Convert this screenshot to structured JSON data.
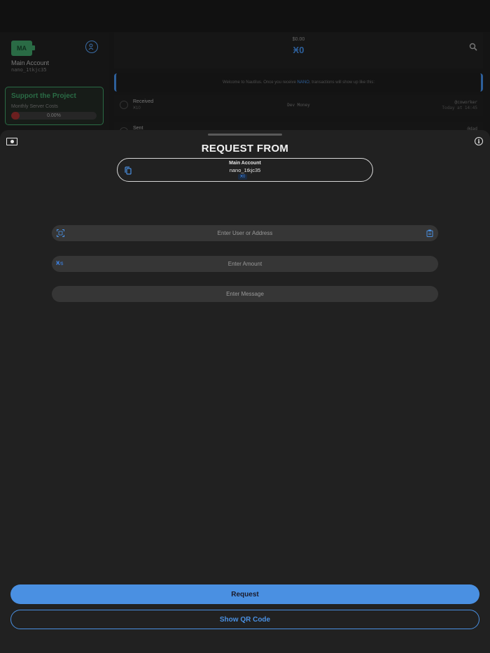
{
  "background": {
    "sidebar": {
      "avatar_initials": "MA",
      "account_name": "Main Account",
      "account_address": "nano_1tkjc35",
      "support": {
        "title": "Support the Project",
        "subtitle": "Monthly Server Costs",
        "progress_label": "0.00%",
        "progress": 0.0
      }
    },
    "header": {
      "fiat_balance": "$0.00",
      "nano_balance": "Ӿ0"
    },
    "welcome": {
      "prefix": "Welcome to Nautilus. Once you receive ",
      "highlight": "NANO",
      "suffix": ", transactions will show up like this:"
    },
    "transactions": [
      {
        "type": "Received",
        "amount": "Ӿ10",
        "contact": "Dev Money",
        "right_top": "@coworker",
        "right_bottom": "Today at 14:45"
      },
      {
        "type": "Sent",
        "amount": "",
        "contact": "",
        "right_top": "@dad",
        "right_bottom": ""
      }
    ]
  },
  "sheet": {
    "title": "REQUEST FROM",
    "account": {
      "name": "Main Account",
      "address": "nano_1tkjc35",
      "balance": "Ӿ0"
    },
    "fields": {
      "user_placeholder": "Enter User or Address",
      "amount_placeholder": "Enter Amount",
      "message_placeholder": "Enter Message",
      "currency_symbol": "Ӿ",
      "currency_alt": "/$"
    },
    "buttons": {
      "request": "Request",
      "show_qr": "Show QR Code"
    }
  },
  "colors": {
    "accent": "#4a90e2",
    "sheet_bg": "#212121",
    "field_bg": "#363636",
    "support_green": "#2a6b45"
  }
}
